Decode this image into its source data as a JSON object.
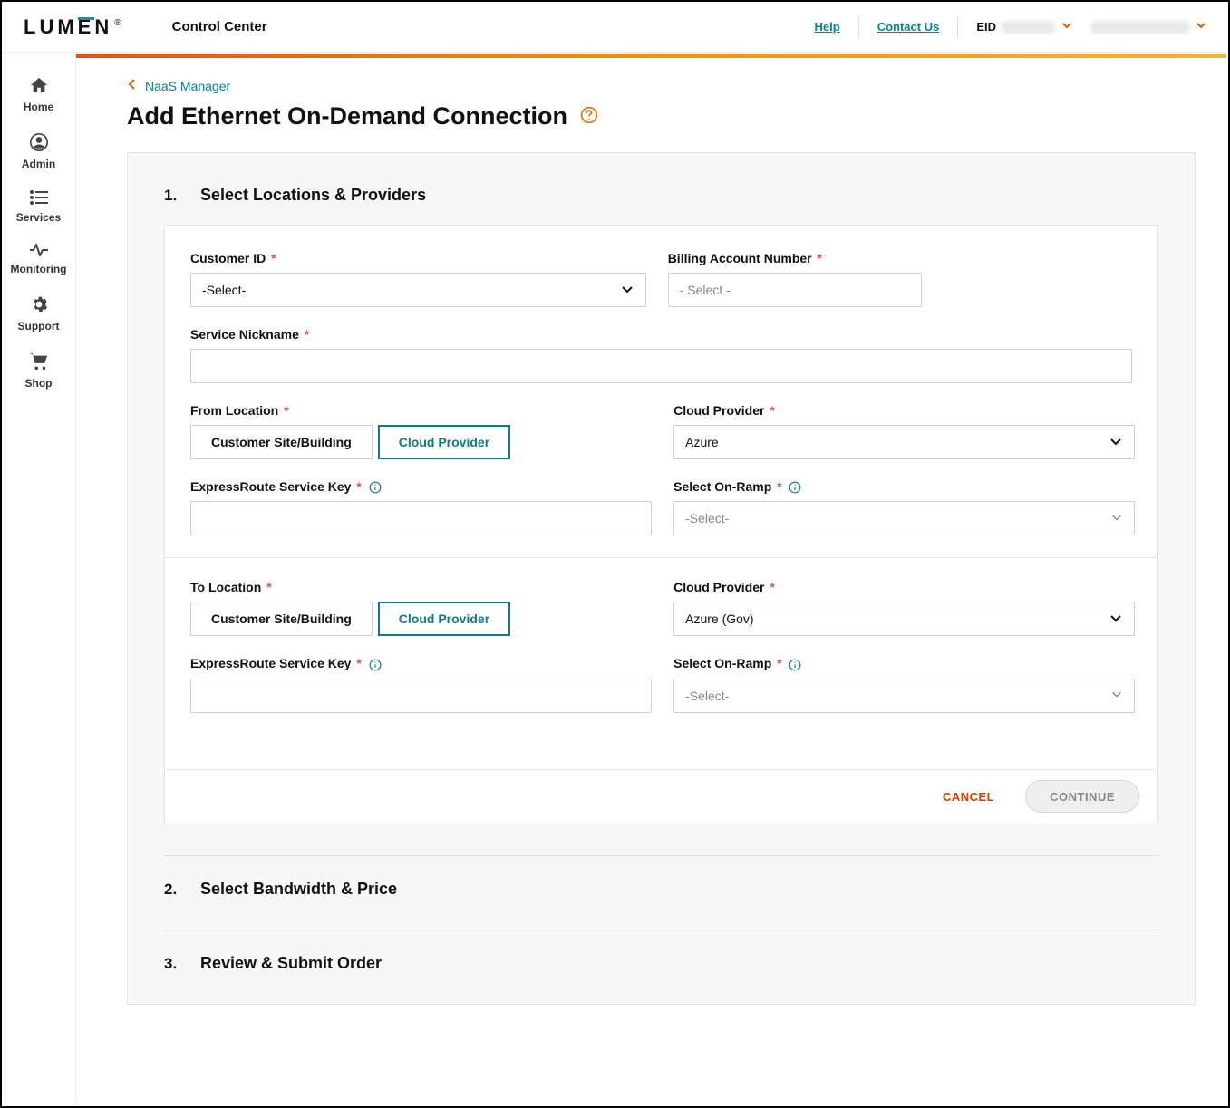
{
  "header": {
    "logo_text": "LUMEN",
    "app_title": "Control Center",
    "help": "Help",
    "contact": "Contact Us",
    "eid_label": "EID"
  },
  "sidebar": [
    {
      "icon": "home",
      "label": "Home"
    },
    {
      "icon": "admin",
      "label": "Admin"
    },
    {
      "icon": "services",
      "label": "Services"
    },
    {
      "icon": "monitoring",
      "label": "Monitoring"
    },
    {
      "icon": "support",
      "label": "Support"
    },
    {
      "icon": "shop",
      "label": "Shop"
    }
  ],
  "breadcrumb": {
    "label": "NaaS Manager"
  },
  "page_title": "Add Ethernet On-Demand Connection",
  "steps": [
    {
      "num": "1.",
      "title": "Select Locations & Providers"
    },
    {
      "num": "2.",
      "title": "Select Bandwidth & Price"
    },
    {
      "num": "3.",
      "title": "Review & Submit Order"
    }
  ],
  "form": {
    "customer_id": {
      "label": "Customer ID",
      "value": "-Select-"
    },
    "billing_account": {
      "label": "Billing Account Number",
      "value": "- Select -"
    },
    "service_nickname": {
      "label": "Service Nickname",
      "value": ""
    },
    "from_location": {
      "label": "From Location",
      "options": {
        "customer": "Customer Site/Building",
        "cloud": "Cloud Provider"
      },
      "selected": "cloud"
    },
    "from_provider": {
      "label": "Cloud Provider",
      "value": "Azure"
    },
    "from_key": {
      "label": "ExpressRoute Service Key",
      "value": ""
    },
    "from_onramp": {
      "label": "Select On-Ramp",
      "value": "-Select-"
    },
    "to_location": {
      "label": "To Location",
      "options": {
        "customer": "Customer Site/Building",
        "cloud": "Cloud Provider"
      },
      "selected": "cloud"
    },
    "to_provider": {
      "label": "Cloud Provider",
      "value": "Azure (Gov)"
    },
    "to_key": {
      "label": "ExpressRoute Service Key",
      "value": ""
    },
    "to_onramp": {
      "label": "Select On-Ramp",
      "value": "-Select-"
    }
  },
  "actions": {
    "cancel": "CANCEL",
    "continue": "CONTINUE"
  }
}
